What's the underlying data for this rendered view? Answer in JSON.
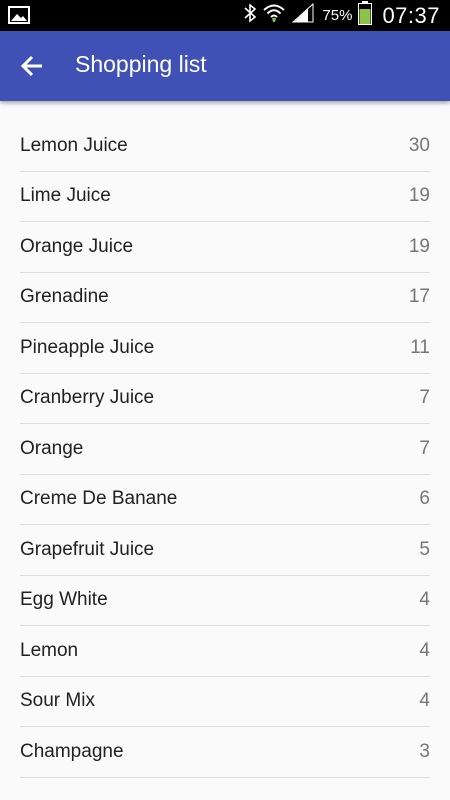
{
  "status_bar": {
    "battery_percent": "75%",
    "time": "07:37",
    "icons": [
      "image-notification-icon",
      "bluetooth-icon",
      "wifi-icon",
      "signal-icon",
      "battery-charging-icon"
    ]
  },
  "app_bar": {
    "title": "Shopping list",
    "back_icon": "arrow-back-icon",
    "color": "#3f51b5"
  },
  "items": [
    {
      "name": "Lemon Juice",
      "count": "30"
    },
    {
      "name": "Lime Juice",
      "count": "19"
    },
    {
      "name": "Orange Juice",
      "count": "19"
    },
    {
      "name": "Grenadine",
      "count": "17"
    },
    {
      "name": "Pineapple Juice",
      "count": "11"
    },
    {
      "name": "Cranberry Juice",
      "count": "7"
    },
    {
      "name": "Orange",
      "count": "7"
    },
    {
      "name": "Creme De Banane",
      "count": "6"
    },
    {
      "name": "Grapefruit Juice",
      "count": "5"
    },
    {
      "name": "Egg White",
      "count": "4"
    },
    {
      "name": "Lemon",
      "count": "4"
    },
    {
      "name": "Sour Mix",
      "count": "4"
    },
    {
      "name": "Champagne",
      "count": "3"
    }
  ]
}
